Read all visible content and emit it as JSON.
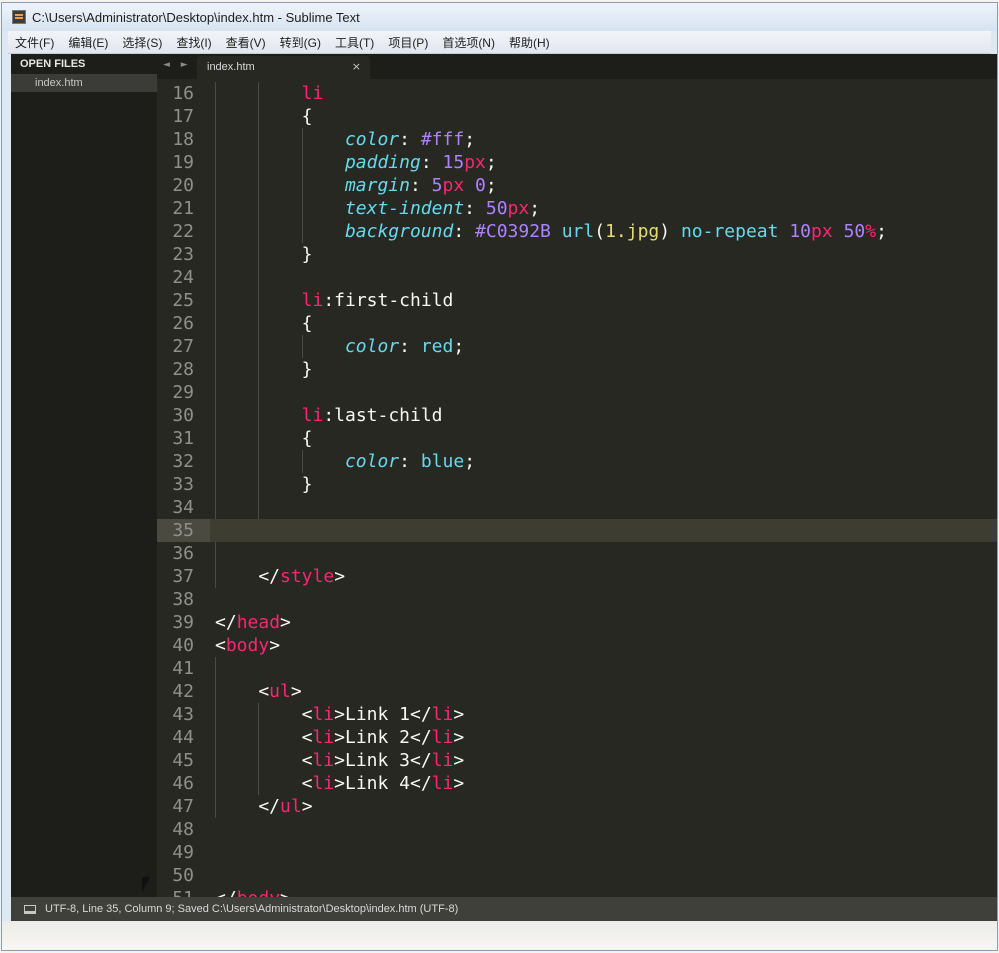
{
  "window": {
    "title": "C:\\Users\\Administrator\\Desktop\\index.htm - Sublime Text"
  },
  "menu": [
    "文件(F)",
    "编辑(E)",
    "选择(S)",
    "查找(I)",
    "查看(V)",
    "转到(G)",
    "工具(T)",
    "项目(P)",
    "首选项(N)",
    "帮助(H)"
  ],
  "sidebar": {
    "header": "OPEN FILES",
    "files": [
      "index.htm"
    ]
  },
  "tabs": [
    {
      "label": "index.htm",
      "close": "×"
    }
  ],
  "tab_nav": "◄ ►",
  "editor": {
    "active_line": "35",
    "lines": [
      {
        "no": "16",
        "indent": 2,
        "tokens": [
          [
            "tg",
            "li"
          ]
        ]
      },
      {
        "no": "17",
        "indent": 2,
        "tokens": [
          [
            "",
            "{"
          ]
        ]
      },
      {
        "no": "18",
        "indent": 3,
        "tokens": [
          [
            "pr",
            "color"
          ],
          [
            "",
            ": "
          ],
          [
            "nm",
            "#fff"
          ],
          [
            "",
            ";"
          ]
        ]
      },
      {
        "no": "19",
        "indent": 3,
        "tokens": [
          [
            "pr",
            "padding"
          ],
          [
            "",
            ": "
          ],
          [
            "nm",
            "15"
          ],
          [
            "un",
            "px"
          ],
          [
            "",
            ";"
          ]
        ]
      },
      {
        "no": "20",
        "indent": 3,
        "tokens": [
          [
            "pr",
            "margin"
          ],
          [
            "",
            ": "
          ],
          [
            "nm",
            "5"
          ],
          [
            "un",
            "px"
          ],
          [
            "",
            " "
          ],
          [
            "nm",
            "0"
          ],
          [
            "",
            ";"
          ]
        ]
      },
      {
        "no": "21",
        "indent": 3,
        "tokens": [
          [
            "pr",
            "text-indent"
          ],
          [
            "",
            ": "
          ],
          [
            "nm",
            "50"
          ],
          [
            "un",
            "px"
          ],
          [
            "",
            ";"
          ]
        ]
      },
      {
        "no": "22",
        "indent": 3,
        "tokens": [
          [
            "pr",
            "background"
          ],
          [
            "",
            ": "
          ],
          [
            "nm",
            "#C0392B"
          ],
          [
            "",
            " "
          ],
          [
            "fn",
            "url"
          ],
          [
            "",
            "("
          ],
          [
            "st",
            "1.jpg"
          ],
          [
            "",
            ") "
          ],
          [
            "fn",
            "no-repeat"
          ],
          [
            "",
            " "
          ],
          [
            "nm",
            "10"
          ],
          [
            "un",
            "px"
          ],
          [
            "",
            " "
          ],
          [
            "nm",
            "50"
          ],
          [
            "un",
            "%"
          ],
          [
            "",
            ";"
          ]
        ]
      },
      {
        "no": "23",
        "indent": 2,
        "tokens": [
          [
            "",
            "}"
          ]
        ]
      },
      {
        "no": "24",
        "indent": 2,
        "tokens": []
      },
      {
        "no": "25",
        "indent": 2,
        "tokens": [
          [
            "tg",
            "li"
          ],
          [
            "",
            ":first-child"
          ]
        ]
      },
      {
        "no": "26",
        "indent": 2,
        "tokens": [
          [
            "",
            "{"
          ]
        ]
      },
      {
        "no": "27",
        "indent": 3,
        "tokens": [
          [
            "pr",
            "color"
          ],
          [
            "",
            ": "
          ],
          [
            "fn",
            "red"
          ],
          [
            "",
            ";"
          ]
        ]
      },
      {
        "no": "28",
        "indent": 2,
        "tokens": [
          [
            "",
            "}"
          ]
        ]
      },
      {
        "no": "29",
        "indent": 2,
        "tokens": []
      },
      {
        "no": "30",
        "indent": 2,
        "tokens": [
          [
            "tg",
            "li"
          ],
          [
            "",
            ":last-child"
          ]
        ]
      },
      {
        "no": "31",
        "indent": 2,
        "tokens": [
          [
            "",
            "{"
          ]
        ]
      },
      {
        "no": "32",
        "indent": 3,
        "tokens": [
          [
            "pr",
            "color"
          ],
          [
            "",
            ": "
          ],
          [
            "fn",
            "blue"
          ],
          [
            "",
            ";"
          ]
        ]
      },
      {
        "no": "33",
        "indent": 2,
        "tokens": [
          [
            "",
            "}"
          ]
        ]
      },
      {
        "no": "34",
        "indent": 2,
        "tokens": []
      },
      {
        "no": "35",
        "indent": 0,
        "tokens": []
      },
      {
        "no": "36",
        "indent": 1,
        "tokens": []
      },
      {
        "no": "37",
        "indent": 1,
        "tokens": [
          [
            "",
            "</"
          ],
          [
            "tg",
            "style"
          ],
          [
            "",
            ">"
          ]
        ]
      },
      {
        "no": "38",
        "indent": 0,
        "tokens": []
      },
      {
        "no": "39",
        "indent": 0,
        "tokens": [
          [
            "",
            "</"
          ],
          [
            "tg",
            "head"
          ],
          [
            "",
            ">"
          ]
        ]
      },
      {
        "no": "40",
        "indent": 0,
        "tokens": [
          [
            "",
            "<"
          ],
          [
            "tg",
            "body"
          ],
          [
            "",
            ">"
          ]
        ]
      },
      {
        "no": "41",
        "indent": 1,
        "tokens": []
      },
      {
        "no": "42",
        "indent": 1,
        "tokens": [
          [
            "",
            "<"
          ],
          [
            "tg",
            "ul"
          ],
          [
            "",
            ">"
          ]
        ]
      },
      {
        "no": "43",
        "indent": 2,
        "tokens": [
          [
            "",
            "<"
          ],
          [
            "tg",
            "li"
          ],
          [
            "",
            ">Link 1</"
          ],
          [
            "tg",
            "li"
          ],
          [
            "",
            ">"
          ]
        ]
      },
      {
        "no": "44",
        "indent": 2,
        "tokens": [
          [
            "",
            "<"
          ],
          [
            "tg",
            "li"
          ],
          [
            "",
            ">Link 2</"
          ],
          [
            "tg",
            "li"
          ],
          [
            "",
            ">"
          ]
        ]
      },
      {
        "no": "45",
        "indent": 2,
        "tokens": [
          [
            "",
            "<"
          ],
          [
            "tg",
            "li"
          ],
          [
            "",
            ">Link 3</"
          ],
          [
            "tg",
            "li"
          ],
          [
            "",
            ">"
          ]
        ]
      },
      {
        "no": "46",
        "indent": 2,
        "tokens": [
          [
            "",
            "<"
          ],
          [
            "tg",
            "li"
          ],
          [
            "",
            ">Link 4</"
          ],
          [
            "tg",
            "li"
          ],
          [
            "",
            ">"
          ]
        ]
      },
      {
        "no": "47",
        "indent": 1,
        "tokens": [
          [
            "",
            "</"
          ],
          [
            "tg",
            "ul"
          ],
          [
            "",
            ">"
          ]
        ]
      },
      {
        "no": "48",
        "indent": 0,
        "tokens": []
      },
      {
        "no": "49",
        "indent": 0,
        "tokens": []
      },
      {
        "no": "50",
        "indent": 0,
        "tokens": []
      },
      {
        "no": "51",
        "indent": 0,
        "tokens": [
          [
            "",
            "</"
          ],
          [
            "tg",
            "body"
          ],
          [
            "",
            ">"
          ]
        ]
      }
    ]
  },
  "status": {
    "text": "UTF-8, Line 35, Column 9; Saved C:\\Users\\Administrator\\Desktop\\index.htm (UTF-8)"
  }
}
